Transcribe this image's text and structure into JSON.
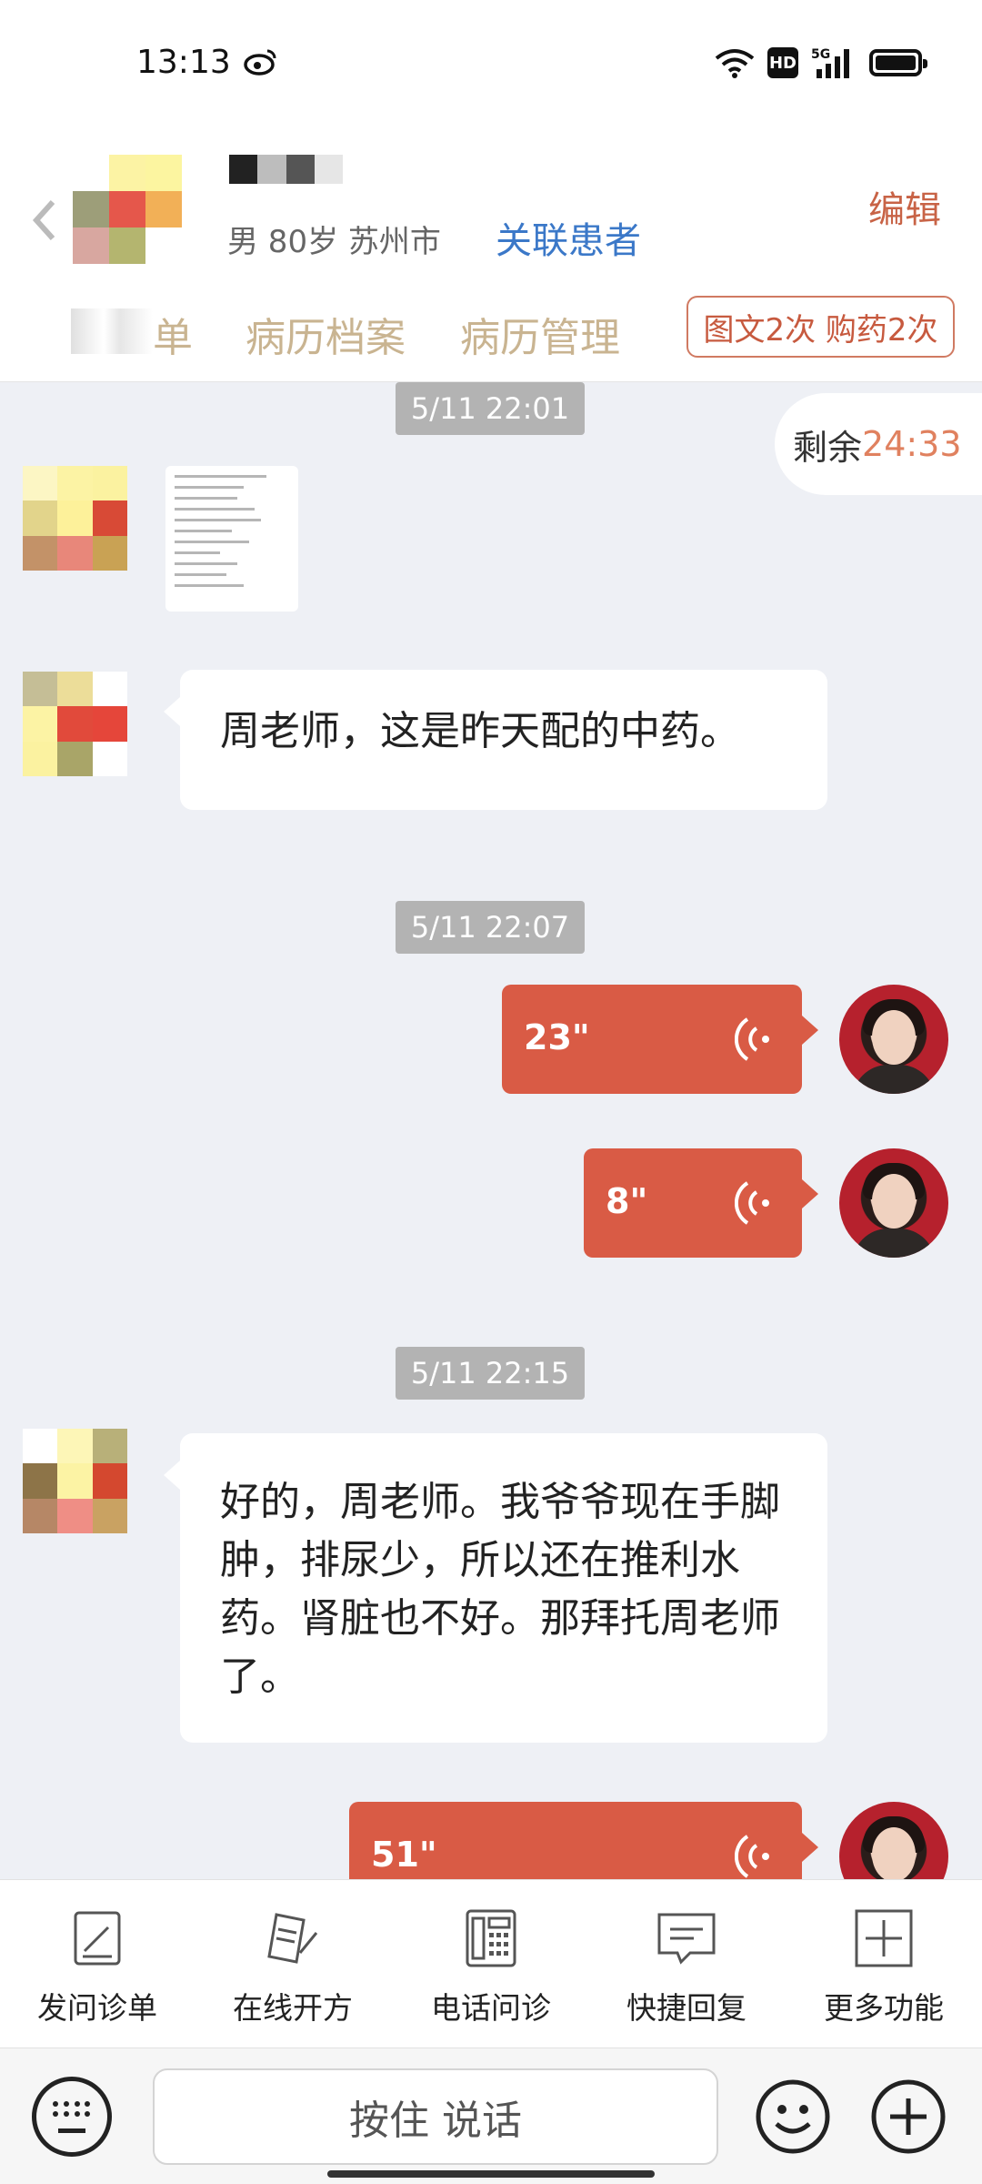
{
  "status_bar": {
    "time": "13:13",
    "hd_label": "HD",
    "network": "5G"
  },
  "header": {
    "patient_meta": "男 80岁  苏州市",
    "link_patient": "关联患者",
    "edit": "编辑",
    "tabs": [
      "单",
      "病历档案",
      "病历管理"
    ],
    "quota_badge": "图文2次 购药2次"
  },
  "chat": {
    "remaining_label": "剩余",
    "remaining_value": "24:33",
    "timestamps": [
      "5/11 22:01",
      "5/11 22:07",
      "5/11 22:15"
    ],
    "messages": [
      {
        "type": "image",
        "from": "patient"
      },
      {
        "type": "text",
        "from": "patient",
        "text": "周老师，这是昨天配的中药。"
      },
      {
        "type": "voice",
        "from": "doctor",
        "duration": "23\""
      },
      {
        "type": "voice",
        "from": "doctor",
        "duration": "8\""
      },
      {
        "type": "text",
        "from": "patient",
        "text": "好的，周老师。我爷爷现在手脚肿，排尿少，所以还在推利水药。肾脏也不好。那拜托周老师了。"
      },
      {
        "type": "voice",
        "from": "doctor",
        "duration": "51\""
      }
    ]
  },
  "toolbar": {
    "items": [
      {
        "label": "发问诊单",
        "icon": "form-edit-icon"
      },
      {
        "label": "在线开方",
        "icon": "prescription-icon"
      },
      {
        "label": "电话问诊",
        "icon": "phone-icon"
      },
      {
        "label": "快捷回复",
        "icon": "quick-reply-icon"
      },
      {
        "label": "更多功能",
        "icon": "more-plus-icon"
      }
    ]
  },
  "input_bar": {
    "hold_to_talk": "按住 说话"
  },
  "colors": {
    "accent": "#d95b45",
    "link": "#3b78c8",
    "tab_text": "#c9b491"
  }
}
